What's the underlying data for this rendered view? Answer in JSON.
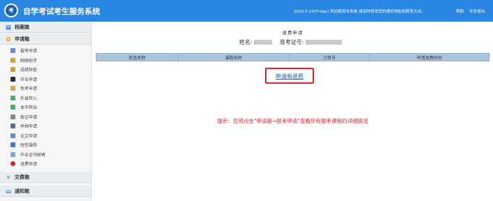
{
  "header": {
    "logo_icon": "exam-seal-icon",
    "title": "自学考试考生服务系统",
    "notice": "2020-5-22(Friday) 欢迎使用本系统,请及时修改您的通讯地址和联系方式。",
    "help": "帮助",
    "logout": "安全退出",
    "bg_color": "#2a86e3"
  },
  "sidebar": {
    "sections": [
      {
        "label": "档案箱",
        "icon": "archive-box-icon"
      },
      {
        "label": "申请箱",
        "icon": "application-box-icon"
      },
      {
        "label": "交费箱",
        "icon": "payment-box-icon"
      },
      {
        "label": "通知箱",
        "icon": "notice-box-icon"
      }
    ],
    "items": [
      {
        "label": "报考申请",
        "icon": "document-icon",
        "color": "#5b8fd6"
      },
      {
        "label": "网络助学",
        "icon": "network-study-icon",
        "color": "#e59b2b"
      },
      {
        "label": "成绩核查",
        "icon": "score-check-icon",
        "color": "#c8a23a"
      },
      {
        "label": "毕业申请",
        "icon": "graduation-cap-icon",
        "color": "#2d2d2d"
      },
      {
        "label": "免考申请",
        "icon": "exemption-icon",
        "color": "#d9a441"
      },
      {
        "label": "外省转入",
        "icon": "transfer-in-icon",
        "color": "#4caf6a"
      },
      {
        "label": "本市转出",
        "icon": "transfer-out-icon",
        "color": "#4caf6a"
      },
      {
        "label": "政证申请",
        "icon": "certificate-icon",
        "color": "#8a8a8a"
      },
      {
        "label": "并档申请",
        "icon": "merge-file-icon",
        "color": "#5b6f8f"
      },
      {
        "label": "论文申请",
        "icon": "thesis-icon",
        "color": "#5b8fd6"
      },
      {
        "label": "短信服务",
        "icon": "sms-icon",
        "color": "#3c7fd0"
      },
      {
        "label": "毕业证书邮寄",
        "icon": "mail-icon",
        "color": "#7aa7d8"
      },
      {
        "label": "退费申请",
        "icon": "refund-icon",
        "color": "#d9242a"
      }
    ]
  },
  "main": {
    "title": "退费申请",
    "name_label": "姓名:",
    "id_label": "准考证号:",
    "table_headers": [
      "状态名称",
      "课程名称",
      "订单号",
      "申请退费时间"
    ],
    "apply_link": "申请新退费",
    "hint": "提示：您可点击\"申请箱→报考申请\"查看所有报考课程的详细情况"
  }
}
